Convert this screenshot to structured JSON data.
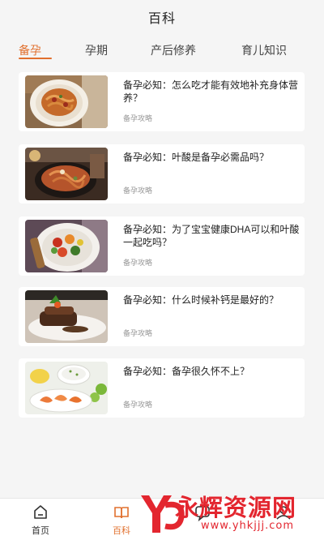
{
  "header": {
    "title": "百科"
  },
  "tabs": [
    {
      "label": "备孕",
      "active": true
    },
    {
      "label": "孕期",
      "active": false
    },
    {
      "label": "产后修养",
      "active": false
    },
    {
      "label": "育儿知识",
      "active": false
    }
  ],
  "articles": [
    {
      "title": "备孕必知：怎么吃才能有效地补充身体营养？",
      "tag": "备孕攻略",
      "image": "pasta-plate"
    },
    {
      "title": "备孕必知：叶酸是备孕必需品吗？",
      "tag": "备孕攻略",
      "image": "noodle-bowl"
    },
    {
      "title": "备孕必知：为了宝宝健康DHA可以和叶酸一起吃吗？",
      "tag": "备孕攻略",
      "image": "salad-plate"
    },
    {
      "title": "备孕必知：什么时候补钙是最好的？",
      "tag": "备孕攻略",
      "image": "steak-plate"
    },
    {
      "title": "备孕必知：备孕很久怀不上？",
      "tag": "备孕攻略",
      "image": "shrimp-rice"
    }
  ],
  "bottom_nav": [
    {
      "label": "首页",
      "icon": "home-icon",
      "active": false
    },
    {
      "label": "百科",
      "icon": "book-icon",
      "active": true
    },
    {
      "label": "",
      "icon": "message-icon",
      "active": false
    },
    {
      "label": "",
      "icon": "user-icon",
      "active": false
    }
  ],
  "watermark": {
    "text": "永辉资源网",
    "url": "www.yhkjjj.com"
  },
  "colors": {
    "accent": "#e1702e",
    "background": "#f5f5f5",
    "card": "#ffffff",
    "watermark": "#e3262f"
  }
}
